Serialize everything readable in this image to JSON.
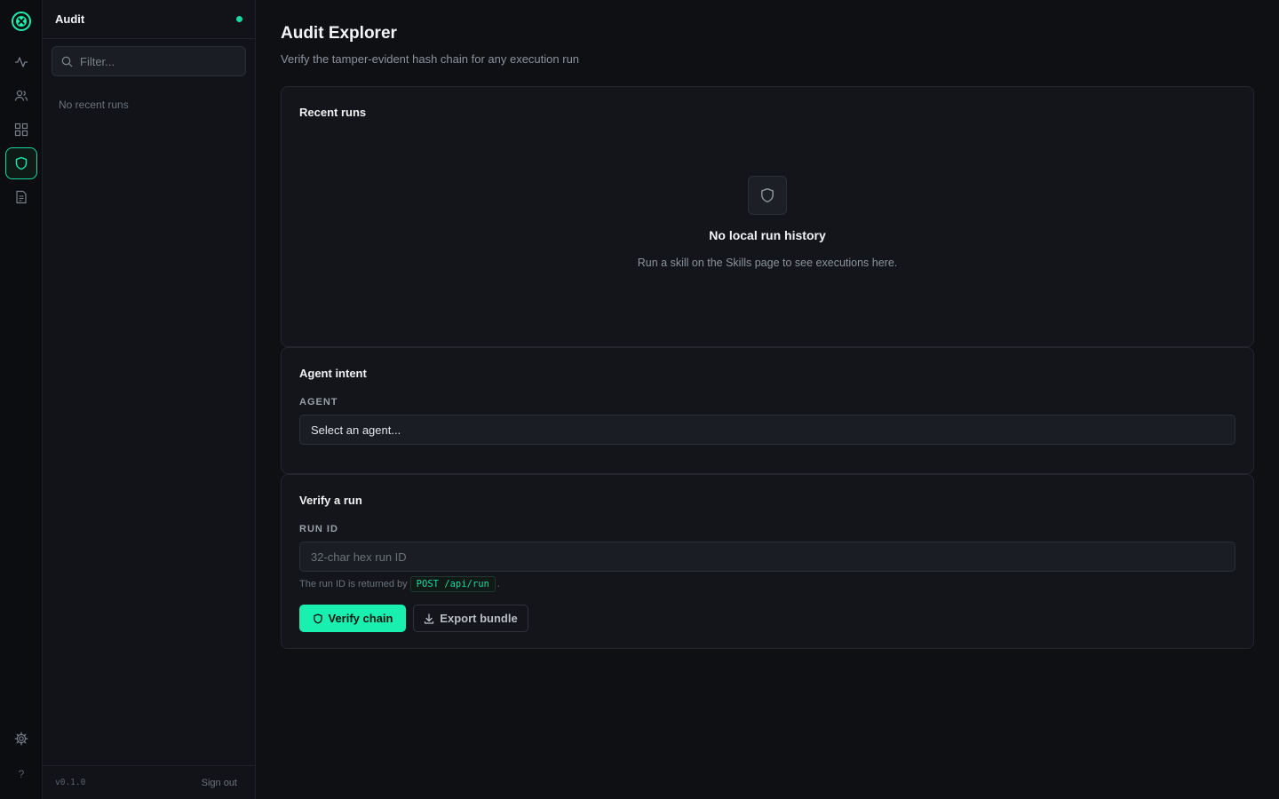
{
  "rail": {
    "logo_icon": "x-circle-logo",
    "items": [
      {
        "name": "activity-icon"
      },
      {
        "name": "users-icon"
      },
      {
        "name": "skills-grid-icon"
      },
      {
        "name": "shield-icon",
        "active": true
      },
      {
        "name": "document-icon"
      }
    ],
    "settings_icon": "gear-icon",
    "help_label": "?"
  },
  "sidebar": {
    "title": "Audit",
    "filter_placeholder": "Filter...",
    "empty_text": "No recent runs",
    "version": "v0.1.0",
    "signout": "Sign out"
  },
  "main": {
    "title": "Audit Explorer",
    "subtitle": "Verify the tamper-evident hash chain for any execution run",
    "recent": {
      "title": "Recent runs",
      "empty_title": "No local run history",
      "empty_desc": "Run a skill on the Skills page to see executions here."
    },
    "intent": {
      "title": "Agent intent",
      "label": "AGENT",
      "select_value": "Select an agent..."
    },
    "verify": {
      "title": "Verify a run",
      "label": "RUN ID",
      "input_placeholder": "32-char hex run ID",
      "hint_prefix": "The run ID is returned by",
      "hint_code": "POST /api/run",
      "hint_suffix": ".",
      "verify_button": "Verify chain",
      "export_button": "Export bundle"
    }
  },
  "colors": {
    "accent": "#19f0b0",
    "background": "#0e1014",
    "card": "#13151a"
  }
}
